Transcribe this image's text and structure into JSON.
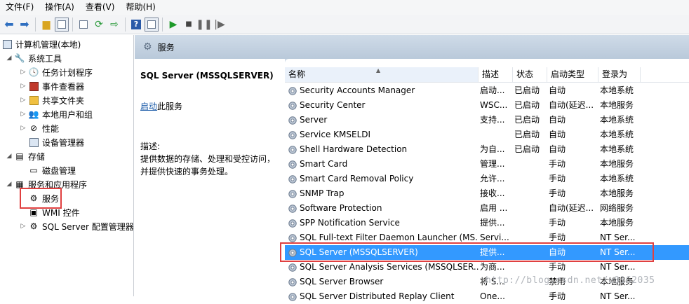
{
  "menu": [
    "文件(F)",
    "操作(A)",
    "查看(V)",
    "帮助(H)"
  ],
  "toolbar": {
    "icons": [
      "back-arrow-icon",
      "forward-arrow-icon",
      "up-folder-icon",
      "show-hide-tree-icon",
      "properties-icon",
      "refresh-icon",
      "export-list-icon",
      "help-icon",
      "show-hide-action-pane-icon",
      "start-service-icon",
      "stop-service-icon",
      "pause-service-icon",
      "resume-service-icon"
    ]
  },
  "tree": {
    "root": "计算机管理(本地)",
    "system_tools": "系统工具",
    "task_scheduler": "任务计划程序",
    "event_viewer": "事件查看器",
    "shared_folders": "共享文件夹",
    "local_users": "本地用户和组",
    "performance": "性能",
    "device_manager": "设备管理器",
    "storage": "存储",
    "disk_management": "磁盘管理",
    "services_apps": "服务和应用程序",
    "services": "服务",
    "wmi": "WMI 控件",
    "sql_config": "SQL Server 配置管理器"
  },
  "header": {
    "title": "服务"
  },
  "detail": {
    "service_name": "SQL Server (MSSQLSERVER)",
    "start_link": "启动",
    "start_suffix": "此服务",
    "desc_label": "描述:",
    "desc_line1": "提供数据的存储、处理和受控访问，",
    "desc_line2": "并提供快速的事务处理。"
  },
  "columns": {
    "name": "名称",
    "desc": "描述",
    "status": "状态",
    "startup": "启动类型",
    "logon": "登录为"
  },
  "services": [
    {
      "name": "Security Accounts Manager",
      "desc": "启动...",
      "status": "已启动",
      "startup": "自动",
      "logon": "本地系统"
    },
    {
      "name": "Security Center",
      "desc": "WSC...",
      "status": "已启动",
      "startup": "自动(延迟...",
      "logon": "本地服务"
    },
    {
      "name": "Server",
      "desc": "支持...",
      "status": "已启动",
      "startup": "自动",
      "logon": "本地系统"
    },
    {
      "name": "Service KMSELDI",
      "desc": "",
      "status": "已启动",
      "startup": "自动",
      "logon": "本地系统"
    },
    {
      "name": "Shell Hardware Detection",
      "desc": "为自...",
      "status": "已启动",
      "startup": "自动",
      "logon": "本地系统"
    },
    {
      "name": "Smart Card",
      "desc": "管理...",
      "status": "",
      "startup": "手动",
      "logon": "本地服务"
    },
    {
      "name": "Smart Card Removal Policy",
      "desc": "允许...",
      "status": "",
      "startup": "手动",
      "logon": "本地系统"
    },
    {
      "name": "SNMP Trap",
      "desc": "接收...",
      "status": "",
      "startup": "手动",
      "logon": "本地服务"
    },
    {
      "name": "Software Protection",
      "desc": "启用 ...",
      "status": "",
      "startup": "自动(延迟...",
      "logon": "网络服务"
    },
    {
      "name": "SPP Notification Service",
      "desc": "提供...",
      "status": "",
      "startup": "手动",
      "logon": "本地服务"
    },
    {
      "name": "SQL Full-text Filter Daemon Launcher (MS...",
      "desc": "Servi...",
      "status": "",
      "startup": "手动",
      "logon": "NT Ser..."
    },
    {
      "name": "SQL Server (MSSQLSERVER)",
      "desc": "提供...",
      "status": "",
      "startup": "自动",
      "logon": "NT Ser..."
    },
    {
      "name": "SQL Server Analysis Services (MSSQLSER...",
      "desc": "为商...",
      "status": "",
      "startup": "手动",
      "logon": "NT Ser..."
    },
    {
      "name": "SQL Server Browser",
      "desc": "将 S...",
      "status": "",
      "startup": "禁用",
      "logon": "本地服务"
    },
    {
      "name": "SQL Server Distributed Replay Client",
      "desc": "One...",
      "status": "",
      "startup": "手动",
      "logon": "NT Ser..."
    }
  ],
  "watermark": "http://blog.csdn.net/u0162035"
}
